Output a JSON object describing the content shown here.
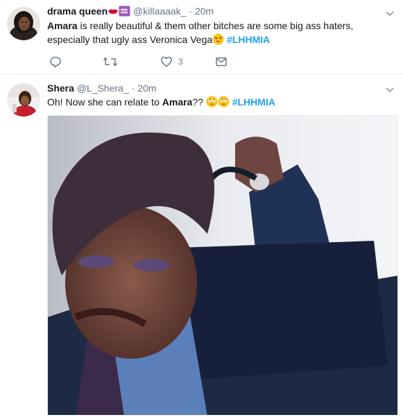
{
  "tweets": [
    {
      "display_name": "drama queen",
      "handle": "@killaaaak_",
      "separator": "·",
      "time": "20m",
      "text_lead": "Amara",
      "text_body": " is really beautiful & them other bitches are some big ass haters, especially that ugly ass Veronica Vega",
      "hashtag": "#LHHMIA",
      "likes": "3",
      "name_emojis": [
        "lips-emoji",
        "aquarius-emoji"
      ],
      "text_emojis": [
        "unamused-face-emoji"
      ]
    },
    {
      "display_name": "Shera",
      "handle": "@L_Shera_",
      "separator": "·",
      "time": "20m",
      "text_pre": "Oh! Now she can relate to ",
      "text_bold": "Amara",
      "text_post": "??",
      "hashtag": "#LHHMIA",
      "text_emojis": [
        "rolling-eyes-emoji",
        "rolling-eyes-emoji"
      ],
      "media": "gif-woman-with-handbag"
    }
  ],
  "colors": {
    "accent": "#1da1f2",
    "secondary_text": "#657786",
    "divider": "#e6ecf0"
  },
  "icons": [
    "reply-icon",
    "retweet-icon",
    "like-icon",
    "direct-message-icon",
    "chevron-down-icon"
  ]
}
